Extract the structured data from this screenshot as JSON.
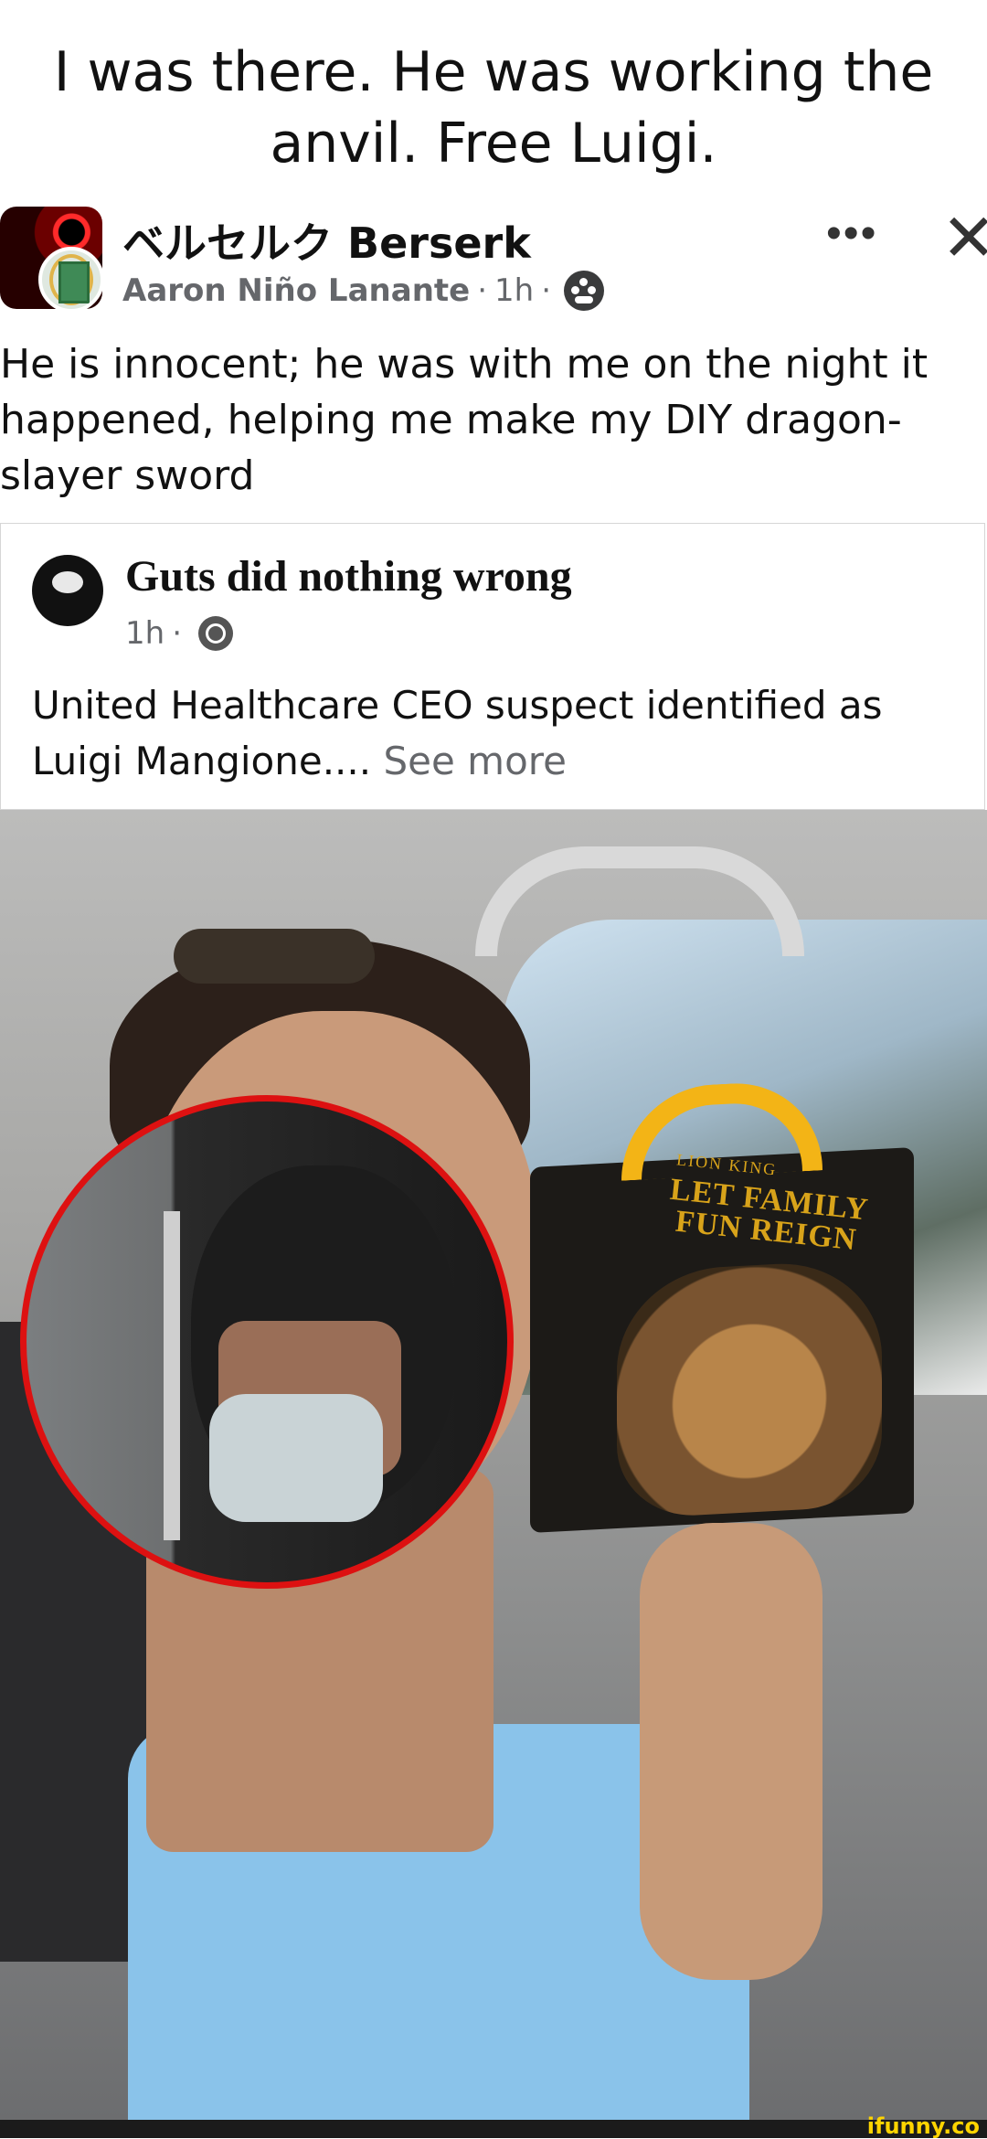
{
  "caption": {
    "line1": "I was there. He was working the",
    "line2": "anvil. Free Luigi."
  },
  "post": {
    "group_name": "ベルセルク Berserk",
    "author": "Aaron Niño Lanante",
    "time": "1h",
    "separator": "·",
    "more_icon": "•••",
    "close_icon": "✕",
    "body": "He is innocent; he was with me on the night it happened, helping me make my DIY dragon-slayer sword"
  },
  "shared": {
    "page_name": "Guts did nothing wrong",
    "time": "1h",
    "separator": "·",
    "text": "United Healthcare CEO suspect identified as Luigi Mangione....",
    "see_more": "See more"
  },
  "photo": {
    "box_brand": "LION KING",
    "box_slogan_line1": "LET FAMILY",
    "box_slogan_line2": "FUN REIGN"
  },
  "watermark": "ifunny.co",
  "colors": {
    "meta_gray": "#65676b",
    "inset_ring": "#dd1111",
    "arches": "#f3b416",
    "watermark": "#ffd400"
  },
  "icons": [
    "more-options-icon",
    "close-icon",
    "group-members-icon",
    "globe-icon"
  ]
}
